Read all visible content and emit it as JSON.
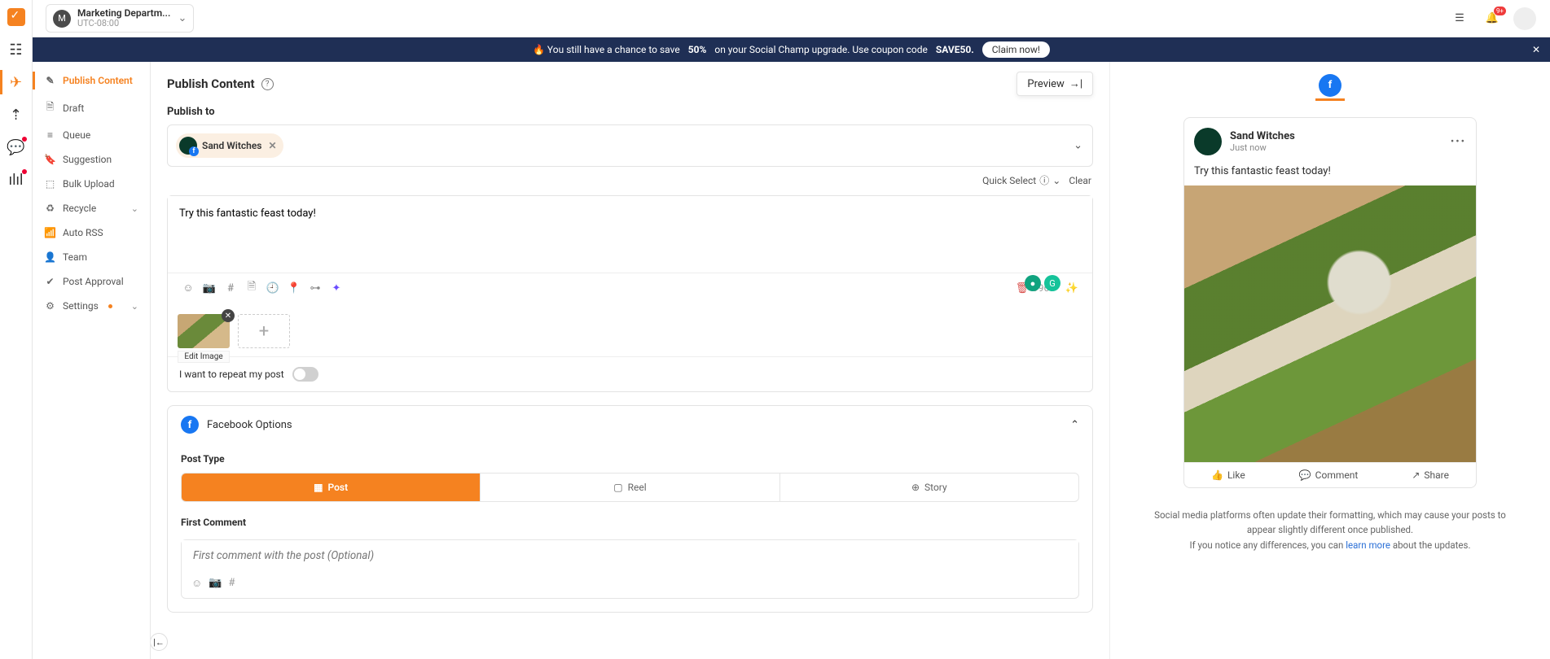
{
  "workspace": {
    "initial": "M",
    "name": "Marketing Departm...",
    "tz": "UTC-08:00"
  },
  "topbar": {
    "notif_badge": "9+"
  },
  "banner": {
    "text_pre": "🔥 You still have a chance to save ",
    "pct": "50%",
    "text_post": " on your Social Champ upgrade. Use coupon code ",
    "code": "SAVE50.",
    "cta": "Claim now!"
  },
  "sidenav": {
    "items": [
      {
        "label": "Publish Content",
        "icon": "✎",
        "active": true
      },
      {
        "label": "Draft",
        "icon": "🗎"
      },
      {
        "label": "Queue",
        "icon": "≡"
      },
      {
        "label": "Suggestion",
        "icon": "⛉"
      },
      {
        "label": "Bulk Upload",
        "icon": "⬚"
      },
      {
        "label": "Recycle",
        "icon": "♻",
        "expandable": true
      },
      {
        "label": "Auto RSS",
        "icon": "📶"
      },
      {
        "label": "Team",
        "icon": "👤"
      },
      {
        "label": "Post Approval",
        "icon": "✔"
      },
      {
        "label": "Settings",
        "icon": "⚙",
        "expandable": true,
        "dot": true
      }
    ]
  },
  "editor": {
    "title": "Publish Content",
    "preview_toggle": "Preview",
    "publish_to_label": "Publish to",
    "destinations": [
      {
        "name": "Sand Witches"
      }
    ],
    "quick_select": "Quick Select",
    "clear": "Clear",
    "composer_text": "Try this fantastic feast today!",
    "char_count": "9969",
    "edit_image": "Edit Image",
    "repeat_label": "I want to repeat my post",
    "fb": {
      "title": "Facebook Options",
      "post_type_label": "Post Type",
      "types": [
        "Post",
        "Reel",
        "Story"
      ],
      "first_comment_label": "First Comment",
      "first_comment_placeholder": "First comment with the post (Optional)"
    }
  },
  "preview": {
    "page_name": "Sand Witches",
    "time": "Just now",
    "body": "Try this fantastic feast today!",
    "actions": {
      "like": "Like",
      "comment": "Comment",
      "share": "Share"
    },
    "note_line1": "Social media platforms often update their formatting, which may cause your posts to appear slightly different once published.",
    "note_line2_pre": "If you notice any differences, you can ",
    "note_learn": "learn more",
    "note_line2_post": " about the updates."
  }
}
